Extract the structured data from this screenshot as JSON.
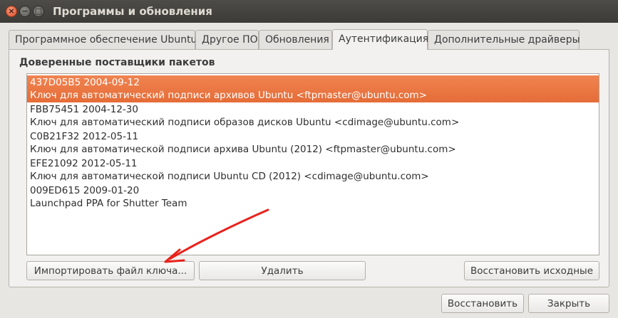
{
  "window": {
    "title": "Программы и обновления",
    "buttons": {
      "close": "×",
      "minimize": "−",
      "maximize": "□"
    }
  },
  "tabs": [
    {
      "label": "Программное обеспечение Ubuntu",
      "active": false
    },
    {
      "label": "Другое ПО",
      "active": false
    },
    {
      "label": "Обновления",
      "active": false
    },
    {
      "label": "Аутентификация",
      "active": true
    },
    {
      "label": "Дополнительные драйверы",
      "active": false
    }
  ],
  "auth": {
    "section_label": "Доверенные поставщики пакетов",
    "keys": [
      {
        "id_date": "437D05B5 2004-09-12",
        "desc": "Ключ для автоматический подписи архивов Ubuntu <ftpmaster@ubuntu.com>",
        "selected": true
      },
      {
        "id_date": "FBB75451 2004-12-30",
        "desc": "Ключ для автоматический подписи образов дисков Ubuntu <cdimage@ubuntu.com>",
        "selected": false
      },
      {
        "id_date": "C0B21F32 2012-05-11",
        "desc": "Ключ для автоматической подписи архива Ubuntu (2012) <ftpmaster@ubuntu.com>",
        "selected": false
      },
      {
        "id_date": "EFE21092 2012-05-11",
        "desc": "Ключ для автоматической подписи Ubuntu CD (2012) <cdimage@ubuntu.com>",
        "selected": false
      },
      {
        "id_date": "009ED615 2009-01-20",
        "desc": "Launchpad PPA for Shutter Team",
        "selected": false
      }
    ],
    "import_button": "Импортировать файл ключа...",
    "remove_button": "Удалить",
    "restore_defaults_button": "Восстановить исходные"
  },
  "footer": {
    "revert_button": "Восстановить",
    "close_button": "Закрыть"
  },
  "colors": {
    "selection": "#e86f3a",
    "annotation_arrow": "#e8221c"
  }
}
